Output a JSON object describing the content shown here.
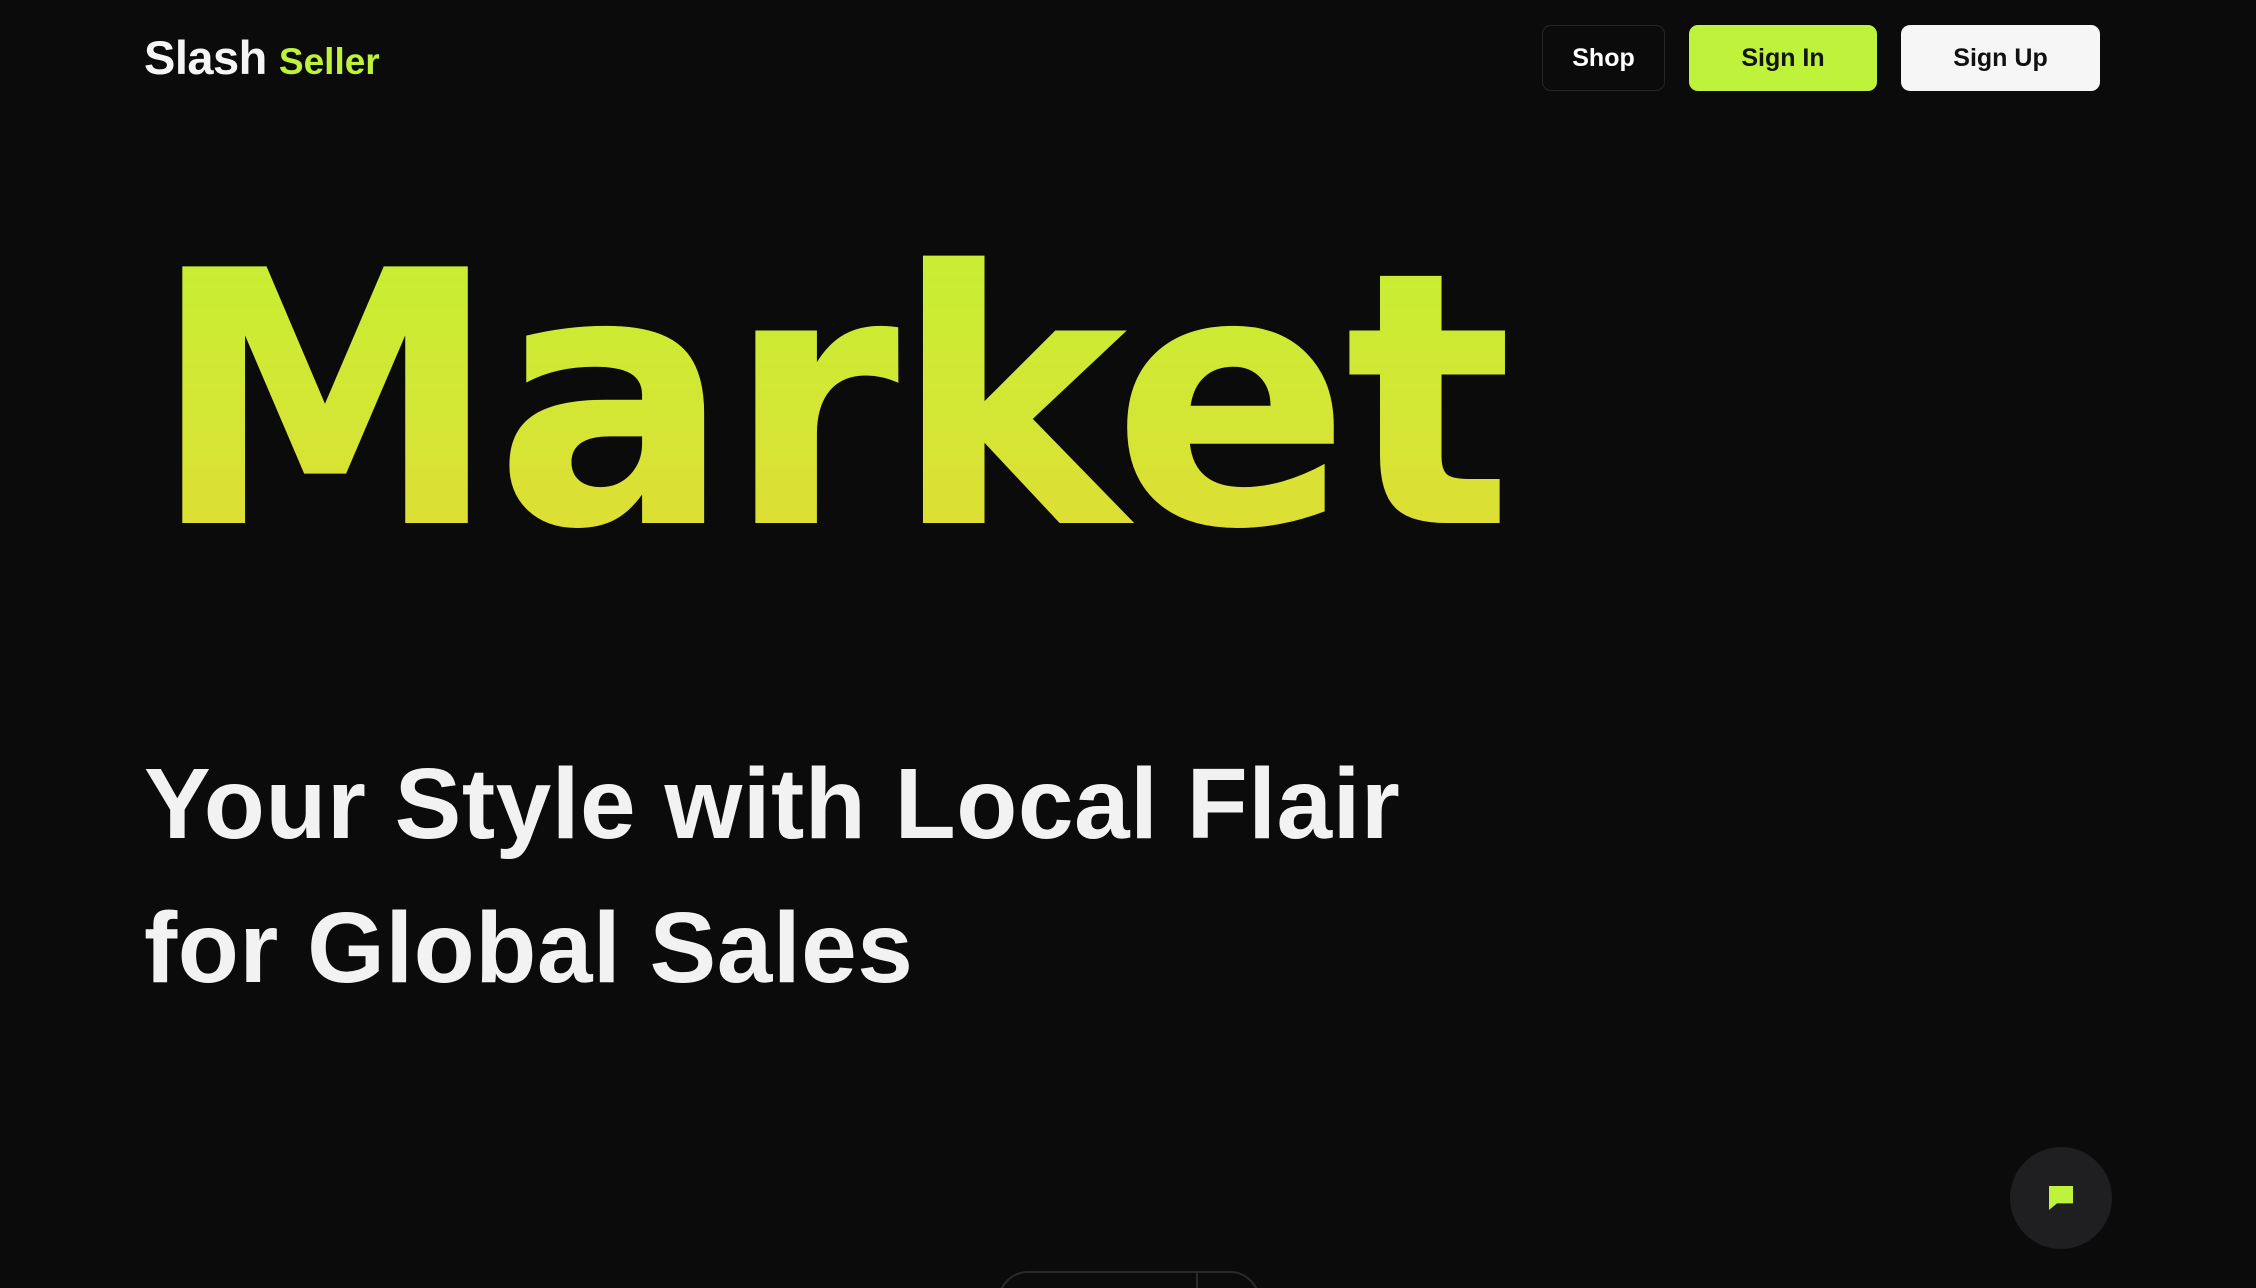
{
  "header": {
    "logo": {
      "primary": "Slash",
      "accent": "Seller"
    },
    "nav": {
      "shop_label": "Shop",
      "sign_in_label": "Sign In",
      "sign_up_label": "Sign Up"
    }
  },
  "hero": {
    "headline": "Market",
    "tagline_line1": "Your Style with Local Flair",
    "tagline_line2": "for Global Sales"
  },
  "chat": {
    "icon": "chat-bubble-icon"
  },
  "colors": {
    "background": "#0b0b0c",
    "accent": "#bff23a",
    "headline_gradient_top": "#c5ef31",
    "headline_gradient_bottom": "#e2db33",
    "text": "#f2f2f2",
    "chat_button": "#1f1f22"
  }
}
